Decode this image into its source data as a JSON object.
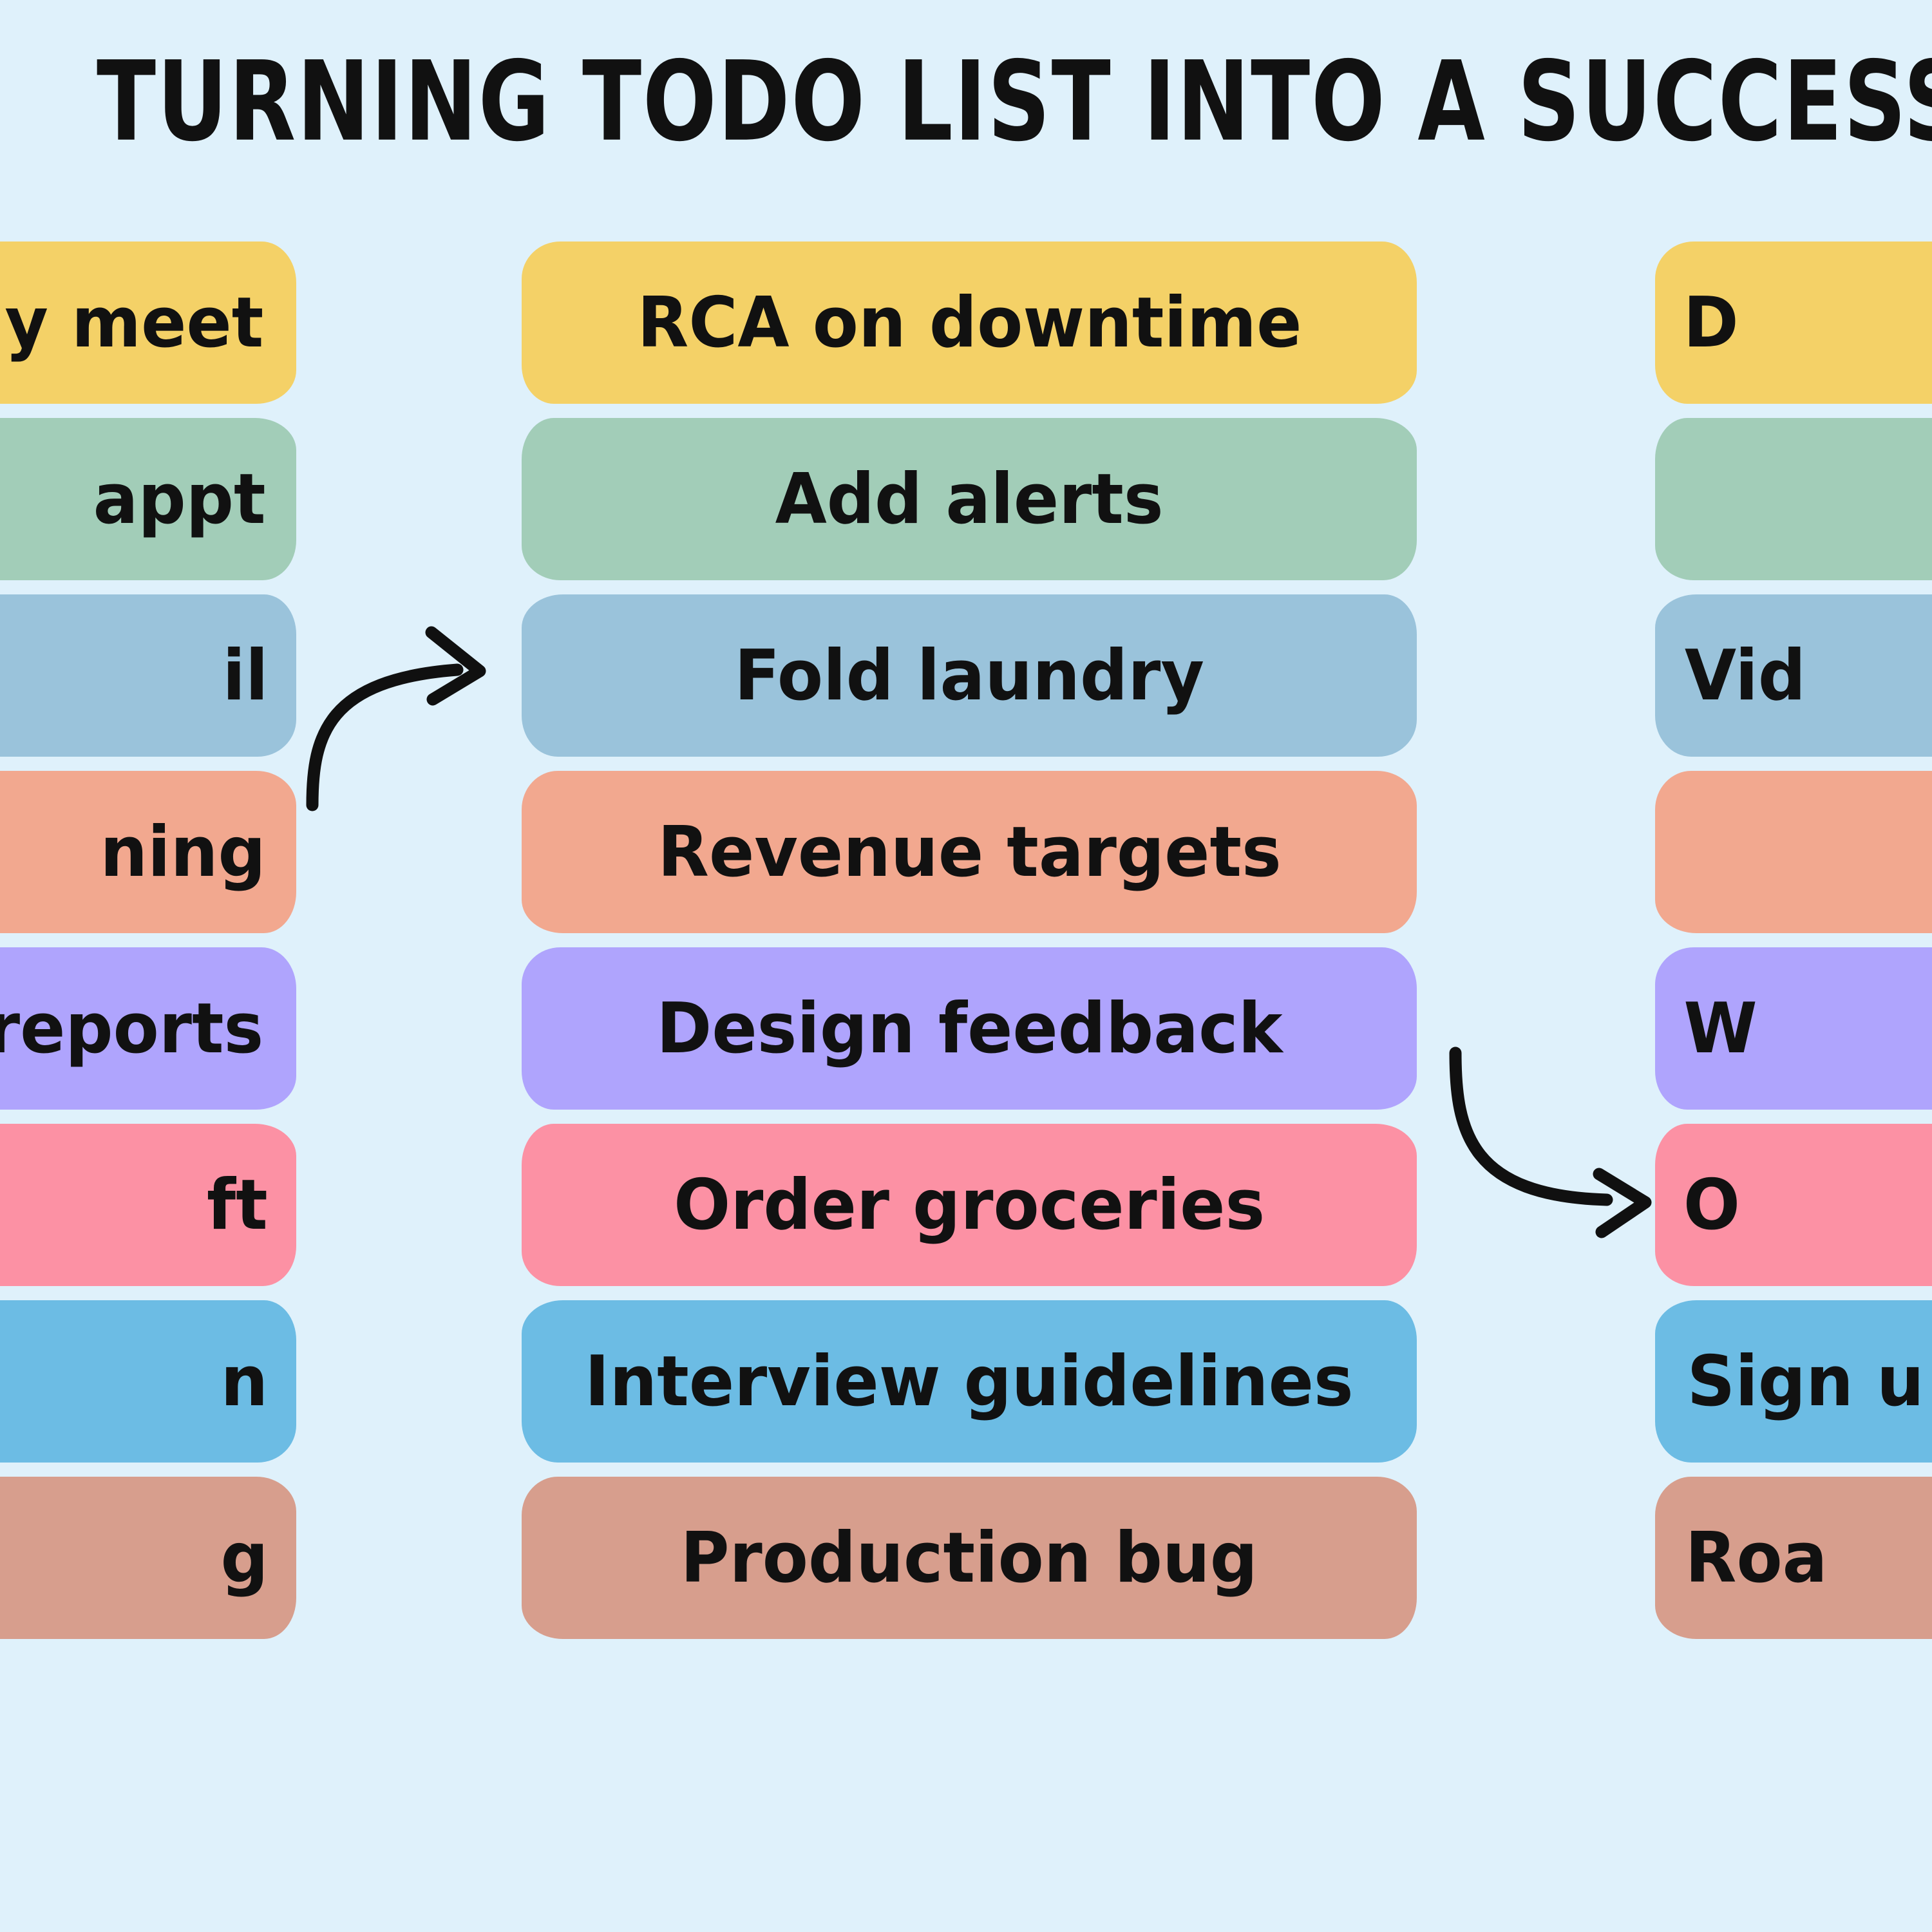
{
  "title": "TURNING TODO LIST INTO A SUCCESS LIST",
  "background_color": "#dff1fb",
  "text_color": "#111111",
  "palette": {
    "yellow": "#f4d167",
    "green": "#a2cdb8",
    "steel_blue": "#9ac3db",
    "salmon": "#f2a88f",
    "purple": "#afa4fd",
    "pink": "#fc91a4",
    "sky_blue": "#6cbce4",
    "terracotta": "#d79e8d"
  },
  "columns": [
    {
      "id": "left",
      "name": "todo-list-column-left",
      "clipped": "left",
      "items": [
        {
          "label": "y meet",
          "color": "#f4d167"
        },
        {
          "label": "appt",
          "color": "#a2cdb8"
        },
        {
          "label": "il",
          "color": "#9ac3db"
        },
        {
          "label": "ning",
          "color": "#f2a88f"
        },
        {
          "label": "reports",
          "color": "#afa4fd"
        },
        {
          "label": "ft",
          "color": "#fc91a4"
        },
        {
          "label": "n",
          "color": "#6cbce4"
        },
        {
          "label": "g",
          "color": "#d79e8d"
        }
      ]
    },
    {
      "id": "center",
      "name": "todo-list-column-center",
      "clipped": "none",
      "items": [
        {
          "label": "RCA on downtime",
          "color": "#f4d167"
        },
        {
          "label": "Add alerts",
          "color": "#a2cdb8"
        },
        {
          "label": "Fold laundry",
          "color": "#9ac3db"
        },
        {
          "label": "Revenue targets",
          "color": "#f2a88f"
        },
        {
          "label": "Design feedback",
          "color": "#afa4fd"
        },
        {
          "label": "Order groceries",
          "color": "#fc91a4"
        },
        {
          "label": "Interview guidelines",
          "color": "#6cbce4"
        },
        {
          "label": "Production bug",
          "color": "#d79e8d"
        }
      ]
    },
    {
      "id": "right",
      "name": "todo-list-column-right",
      "clipped": "right",
      "items": [
        {
          "label": "D",
          "color": "#f4d167"
        },
        {
          "label": "",
          "color": "#a2cdb8"
        },
        {
          "label": "Vid",
          "color": "#9ac3db"
        },
        {
          "label": "",
          "color": "#f2a88f"
        },
        {
          "label": "W",
          "color": "#afa4fd"
        },
        {
          "label": "O",
          "color": "#fc91a4"
        },
        {
          "label": "Sign u",
          "color": "#6cbce4"
        },
        {
          "label": "Roa",
          "color": "#d79e8d"
        }
      ]
    }
  ],
  "arrows": [
    {
      "name": "arrow-left-to-center",
      "direction": "right",
      "curve": "up-then-right"
    },
    {
      "name": "arrow-center-to-right",
      "direction": "right",
      "curve": "down-then-right"
    }
  ]
}
